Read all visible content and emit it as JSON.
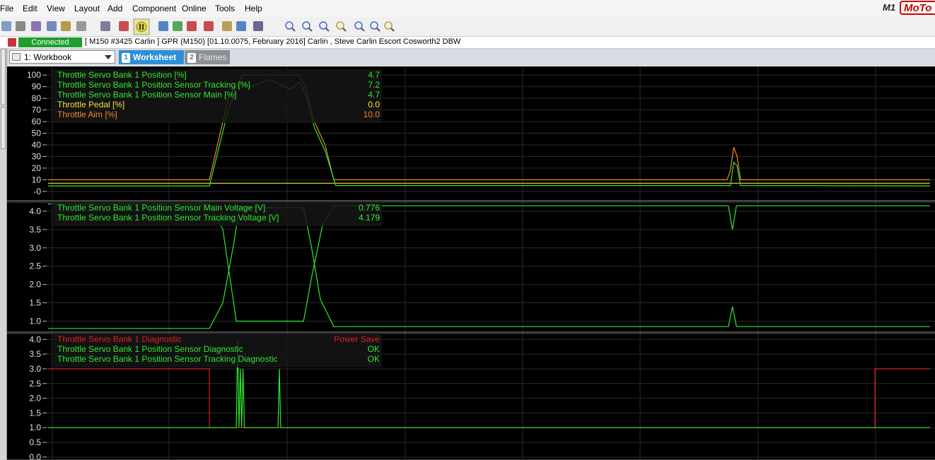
{
  "menu": {
    "items": [
      "File",
      "Edit",
      "View",
      "Layout",
      "Add",
      "Component",
      "Online",
      "Tools",
      "Help"
    ]
  },
  "brand": {
    "m1": "M1",
    "name": "MoTo"
  },
  "toolbar": {
    "icons": [
      "open-icon",
      "save-icon",
      "print-icon",
      "copy-icon",
      "paste-icon",
      "undo-icon",
      "redo-icon",
      "record-icon",
      "pause-icon",
      "tile-icon",
      "grid-icon",
      "graph-icon",
      "marker-icon",
      "settings-icon",
      "window-icon",
      "cursor-icon",
      "zoom-icon",
      "zoom-in-icon",
      "zoom-out-icon",
      "zoom-fit-icon",
      "zoom-x-in-icon",
      "zoom-x-out-icon",
      "zoom-y-icon"
    ]
  },
  "status": {
    "badge": "Connected",
    "info": "[ M150 #3425 Carlin ]  GPR (M150) [01.10.0075, February 2016] Carlin , Steve Carlin Escort Cosworth2 DBW"
  },
  "tabs": {
    "workbook": "1: Workbook",
    "worksheet": {
      "num": "1",
      "label": "Worksheet"
    },
    "flames": {
      "num": "2",
      "label": "Flames"
    }
  },
  "colors": {
    "green": "#2ee82e",
    "dark_green": "#1a7a1a",
    "yellow": "#f2e23a",
    "orange": "#f08a2a",
    "red": "#e02020",
    "grid": "#2a2a2a",
    "text": "#e0e0e0"
  },
  "chart_data": [
    {
      "type": "line",
      "name": "position",
      "ylim": [
        -8,
        105
      ],
      "ticks": [
        "100",
        "90",
        "80",
        "70",
        "60",
        "50",
        "40",
        "30",
        "20",
        "10",
        "-0"
      ],
      "tick_values": [
        100,
        90,
        80,
        70,
        60,
        50,
        40,
        30,
        20,
        10,
        0
      ],
      "xlim": [
        0,
        1312
      ],
      "legend": [
        {
          "label": "Throttle Servo Bank 1 Position [%]",
          "value": "4.7",
          "color": "#2ee82e"
        },
        {
          "label": "Throttle Servo Bank 1 Position Sensor Tracking [%]",
          "value": "7.2",
          "color": "#2ee82e"
        },
        {
          "label": "Throttle Servo Bank 1 Position Sensor Main [%]",
          "value": "4.7",
          "color": "#2ee82e"
        },
        {
          "label": "Throttle Pedal [%]",
          "value": "0.0",
          "color": "#f2e23a"
        },
        {
          "label": "Throttle Aim [%]",
          "value": "10.0",
          "color": "#f08a2a"
        }
      ],
      "series": [
        {
          "color": "#f2e23a",
          "points": [
            [
              0,
              7
            ],
            [
              1312,
              7
            ]
          ]
        },
        {
          "color": "#f08a2a",
          "points": [
            [
              0,
              10
            ],
            [
              240,
              10
            ],
            [
              268,
              80
            ],
            [
              290,
              100
            ],
            [
              372,
              100
            ],
            [
              382,
              92
            ],
            [
              396,
              60
            ],
            [
              412,
              40
            ],
            [
              425,
              10
            ],
            [
              1010,
              10
            ],
            [
              1015,
              18
            ],
            [
              1020,
              38
            ],
            [
              1025,
              30
            ],
            [
              1030,
              10
            ],
            [
              1312,
              10
            ]
          ]
        },
        {
          "color": "#2ee82e",
          "points": [
            [
              0,
              4.7
            ],
            [
              240,
              4.7
            ],
            [
              268,
              70
            ],
            [
              285,
              95
            ],
            [
              300,
              90
            ],
            [
              330,
              96
            ],
            [
              360,
              88
            ],
            [
              375,
              94
            ],
            [
              385,
              80
            ],
            [
              396,
              55
            ],
            [
              412,
              35
            ],
            [
              428,
              5
            ],
            [
              1015,
              5
            ],
            [
              1020,
              25
            ],
            [
              1025,
              22
            ],
            [
              1030,
              5
            ],
            [
              1312,
              4.7
            ]
          ]
        }
      ]
    },
    {
      "type": "line",
      "name": "voltage",
      "ylim": [
        0.7,
        4.25
      ],
      "ticks": [
        "4.0",
        "3.5",
        "3.0",
        "2.5",
        "2.0",
        "1.5",
        "1.0"
      ],
      "tick_values": [
        4.0,
        3.5,
        3.0,
        2.5,
        2.0,
        1.5,
        1.0
      ],
      "xlim": [
        0,
        1312
      ],
      "legend": [
        {
          "label": "Throttle Servo Bank 1 Position Sensor Main Voltage [V]",
          "value": "0.776",
          "color": "#2ee82e"
        },
        {
          "label": "Throttle Servo Bank 1 Position Sensor Tracking Voltage [V]",
          "value": "4.179",
          "color": "#2ee82e"
        }
      ],
      "series": [
        {
          "color": "#2ee82e",
          "points": [
            [
              0,
              0.8
            ],
            [
              240,
              0.8
            ],
            [
              260,
              1.5
            ],
            [
              275,
              3.0
            ],
            [
              285,
              4.1
            ],
            [
              380,
              4.1
            ],
            [
              392,
              3.0
            ],
            [
              405,
              1.6
            ],
            [
              425,
              0.85
            ],
            [
              1012,
              0.85
            ],
            [
              1018,
              1.4
            ],
            [
              1024,
              0.85
            ],
            [
              1312,
              0.85
            ]
          ]
        },
        {
          "color": "#2ee82e",
          "points": [
            [
              0,
              4.2
            ],
            [
              240,
              4.2
            ],
            [
              260,
              3.5
            ],
            [
              272,
              2.0
            ],
            [
              280,
              1.0
            ],
            [
              380,
              1.0
            ],
            [
              392,
              2.2
            ],
            [
              408,
              3.6
            ],
            [
              425,
              4.15
            ],
            [
              1012,
              4.15
            ],
            [
              1018,
              3.5
            ],
            [
              1024,
              4.15
            ],
            [
              1312,
              4.15
            ]
          ]
        }
      ]
    },
    {
      "type": "line",
      "name": "diagnostic",
      "ylim": [
        -0.1,
        4.2
      ],
      "ticks": [
        "4.0",
        "3.5",
        "3.0",
        "2.5",
        "2.0",
        "1.5",
        "1.0",
        "0.5",
        "0.0"
      ],
      "tick_values": [
        4.0,
        3.5,
        3.0,
        2.5,
        2.0,
        1.5,
        1.0,
        0.5,
        0.0
      ],
      "xlim": [
        0,
        1312
      ],
      "legend": [
        {
          "label": "Throttle Servo Bank 1 Diagnostic",
          "value": "Power Save",
          "color": "#e02020"
        },
        {
          "label": "Throttle Servo Bank 1 Position Sensor Diagnostic",
          "value": "OK",
          "color": "#2ee82e"
        },
        {
          "label": "Throttle Servo Bank 1 Position Sensor Tracking Diagnostic",
          "value": "OK",
          "color": "#2ee82e"
        }
      ],
      "series": [
        {
          "color": "#e02020",
          "points": [
            [
              0,
              3
            ],
            [
              240,
              3
            ],
            [
              240,
              1
            ],
            [
              1230,
              1
            ],
            [
              1230,
              3
            ],
            [
              1312,
              3
            ]
          ]
        },
        {
          "color": "#2ee82e",
          "points": [
            [
              0,
              1
            ],
            [
              280,
              1
            ],
            [
              282,
              4
            ],
            [
              284,
              1
            ],
            [
              286,
              3
            ],
            [
              288,
              1
            ],
            [
              290,
              3
            ],
            [
              292,
              1
            ],
            [
              342,
              1
            ],
            [
              344,
              3
            ],
            [
              346,
              1
            ],
            [
              1312,
              1
            ]
          ]
        }
      ]
    }
  ]
}
